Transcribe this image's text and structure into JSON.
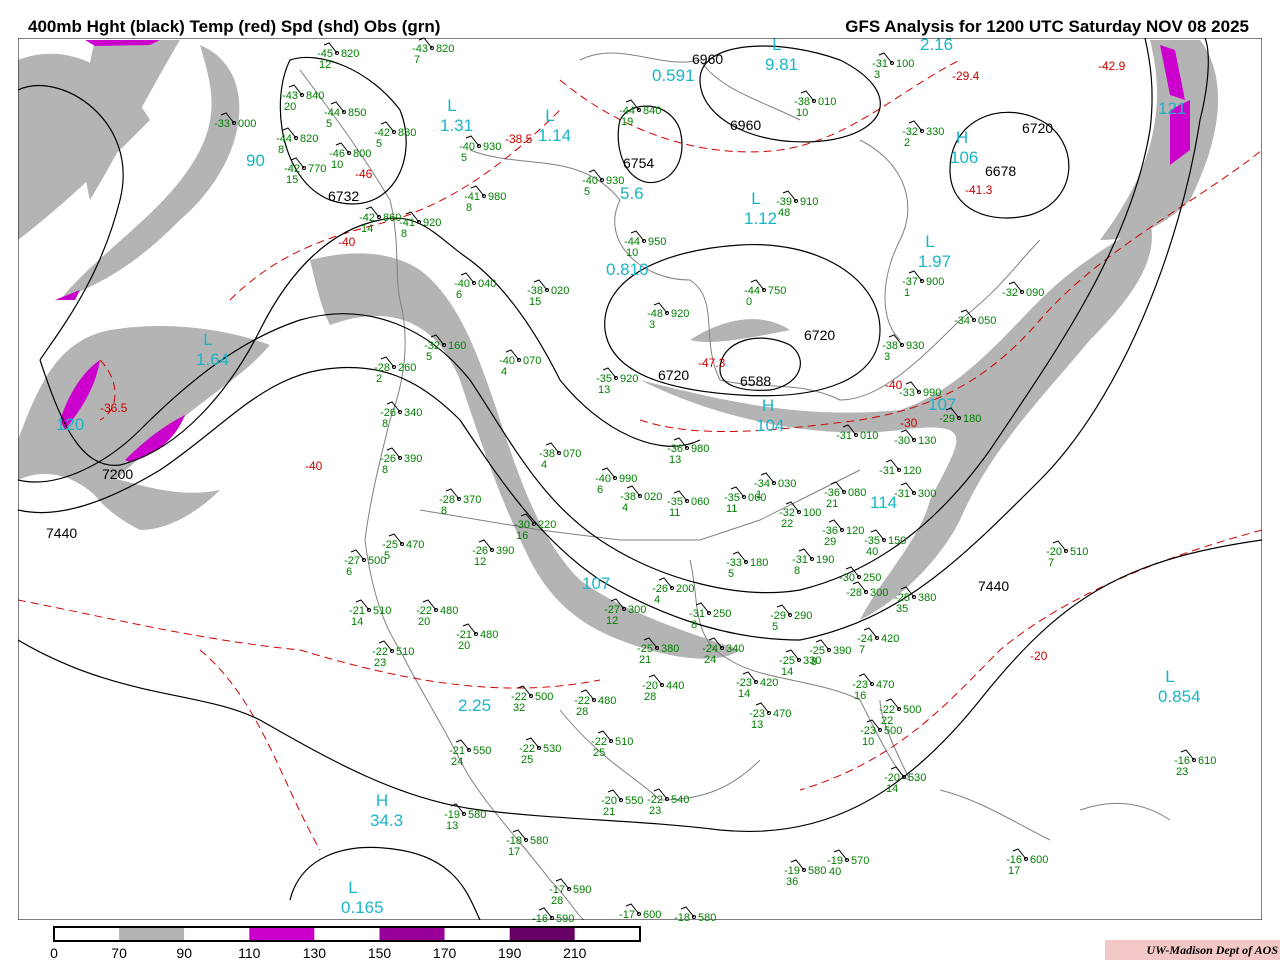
{
  "header": {
    "left_title": "400mb Hght (black) Temp (red) Spd (shd) Obs (grn)",
    "right_title": "GFS Analysis for 1200 UTC Saturday  NOV 08 2025"
  },
  "colors": {
    "height_contour": "#000000",
    "temp_contour": "#d00000",
    "obs": "#008000",
    "speed_label": "#19b5c8",
    "geography": "#808080"
  },
  "legend": {
    "labels": [
      "0",
      "70",
      "90",
      "110",
      "130",
      "150",
      "170",
      "190",
      "210"
    ],
    "colors": [
      "#ffffff",
      "#b4b4b4",
      "#ffffff",
      "#cc00cc",
      "#ffffff",
      "#990099",
      "#ffffff",
      "#660066",
      "#ffffff"
    ]
  },
  "credit": "UW-Madison   Dept of AOS",
  "height_labels": [
    "6732",
    "6754",
    "6960",
    "6960",
    "6720",
    "6678",
    "6720",
    "6720",
    "6588",
    "7200",
    "7440",
    "7440"
  ],
  "temp_labels": [
    "-38.5",
    "-36.5",
    "-29.4",
    "-42.9",
    "-41.3",
    "-47.3",
    "-40",
    "-40",
    "-30",
    "-20",
    "-40",
    "-46"
  ],
  "speed_centers": [
    {
      "type": "L",
      "value": "9.81"
    },
    {
      "type": "",
      "value": "0.591"
    },
    {
      "type": "L",
      "value": "1.31"
    },
    {
      "type": "L",
      "value": "1.14"
    },
    {
      "type": "",
      "value": "5.6"
    },
    {
      "type": "",
      "value": "90"
    },
    {
      "type": "L",
      "value": "1.64"
    },
    {
      "type": "",
      "value": "120"
    },
    {
      "type": "",
      "value": "0.810"
    },
    {
      "type": "L",
      "value": "1.12"
    },
    {
      "type": "L",
      "value": "1.97"
    },
    {
      "type": "H",
      "value": "106"
    },
    {
      "type": "",
      "value": "121"
    },
    {
      "type": "",
      "value": "2.16"
    },
    {
      "type": "",
      "value": "107"
    },
    {
      "type": "",
      "value": "2.25"
    },
    {
      "type": "H",
      "value": "34.3"
    },
    {
      "type": "L",
      "value": "0.165"
    },
    {
      "type": "L",
      "value": "0.854"
    },
    {
      "type": "H",
      "value": "104"
    },
    {
      "type": "",
      "value": "114"
    },
    {
      "type": "",
      "value": "107"
    }
  ],
  "observations": [
    [
      "-45",
      "820",
      "12"
    ],
    [
      "-43",
      "820",
      "7"
    ],
    [
      "-43",
      "840",
      "20"
    ],
    [
      "-44",
      "850",
      "5"
    ],
    [
      "-33",
      "000",
      ""
    ],
    [
      "-42",
      "880",
      "5"
    ],
    [
      "-44",
      "820",
      "8"
    ],
    [
      "-46",
      "800",
      "10"
    ],
    [
      "-42",
      "770",
      "15"
    ],
    [
      "-42",
      "860",
      "14"
    ],
    [
      "-41",
      "920",
      "8"
    ],
    [
      "-40",
      "930",
      "5"
    ],
    [
      "-41",
      "980",
      "8"
    ],
    [
      "-44",
      "840",
      "19"
    ],
    [
      "-40",
      "930",
      "5"
    ],
    [
      "-38",
      "010",
      "10"
    ],
    [
      "-31",
      "100",
      "3"
    ],
    [
      "-32",
      "330",
      "2"
    ],
    [
      "-39",
      "910",
      "48"
    ],
    [
      "-44",
      "950",
      "10"
    ],
    [
      "-37",
      "900",
      "1"
    ],
    [
      "-40",
      "040",
      "6"
    ],
    [
      "-38",
      "020",
      "15"
    ],
    [
      "-44",
      "750",
      "0"
    ],
    [
      "-48",
      "920",
      "3"
    ],
    [
      "-32",
      "090",
      ""
    ],
    [
      "-34",
      "050",
      ""
    ],
    [
      "-38",
      "930",
      "3"
    ],
    [
      "-32",
      "160",
      "5"
    ],
    [
      "-40",
      "070",
      "4"
    ],
    [
      "-35",
      "920",
      "13"
    ],
    [
      "-28",
      "260",
      "2"
    ],
    [
      "-26",
      "340",
      "8"
    ],
    [
      "-33",
      "990",
      ""
    ],
    [
      "-29",
      "180",
      ""
    ],
    [
      "-31",
      "010",
      ""
    ],
    [
      "-30",
      "130",
      ""
    ],
    [
      "-26",
      "390",
      "8"
    ],
    [
      "-38",
      "070",
      "4"
    ],
    [
      "-36",
      "980",
      "13"
    ],
    [
      "-31",
      "120",
      ""
    ],
    [
      "-40",
      "990",
      "6"
    ],
    [
      "-38",
      "020",
      "4"
    ],
    [
      "-35",
      "060",
      "11"
    ],
    [
      "-35",
      "060",
      "11"
    ],
    [
      "-34",
      "030",
      "1"
    ],
    [
      "-36",
      "080",
      "21"
    ],
    [
      "-31",
      "300",
      ""
    ],
    [
      "-28",
      "370",
      "8"
    ],
    [
      "-32",
      "100",
      "22"
    ],
    [
      "-30",
      "220",
      "16"
    ],
    [
      "-36",
      "120",
      "29"
    ],
    [
      "-35",
      "150",
      "40"
    ],
    [
      "-25",
      "470",
      "5"
    ],
    [
      "-26",
      "390",
      "12"
    ],
    [
      "-27",
      "500",
      "6"
    ],
    [
      "-33",
      "180",
      "5"
    ],
    [
      "-31",
      "190",
      "8"
    ],
    [
      "-30",
      "250",
      ""
    ],
    [
      "-28",
      "300",
      ""
    ],
    [
      "-25",
      "380",
      "35"
    ],
    [
      "-26",
      "200",
      "4"
    ],
    [
      "-27",
      "300",
      "12"
    ],
    [
      "-31",
      "250",
      "8"
    ],
    [
      "-21",
      "510",
      "14"
    ],
    [
      "-22",
      "480",
      "20"
    ],
    [
      "-29",
      "290",
      "5"
    ],
    [
      "-21",
      "480",
      "20"
    ],
    [
      "-24",
      "420",
      "7"
    ],
    [
      "-22",
      "510",
      "23"
    ],
    [
      "-25",
      "380",
      "21"
    ],
    [
      "-24",
      "340",
      "24"
    ],
    [
      "-25",
      "390",
      "8"
    ],
    [
      "-25",
      "330",
      "14"
    ],
    [
      "-20",
      "440",
      "28"
    ],
    [
      "-22",
      "500",
      "32"
    ],
    [
      "-22",
      "480",
      "28"
    ],
    [
      "-23",
      "420",
      "14"
    ],
    [
      "-23",
      "470",
      "16"
    ],
    [
      "-22",
      "500",
      "22"
    ],
    [
      "-23",
      "470",
      "13"
    ],
    [
      "-23",
      "500",
      "10"
    ],
    [
      "-21",
      "550",
      "24"
    ],
    [
      "-22",
      "530",
      "25"
    ],
    [
      "-22",
      "510",
      "25"
    ],
    [
      "-20",
      "530",
      "14"
    ],
    [
      "-16",
      "610",
      "23"
    ],
    [
      "-20",
      "510",
      "7"
    ],
    [
      "-20",
      "550",
      "21"
    ],
    [
      "-22",
      "540",
      "23"
    ],
    [
      "-19",
      "580",
      "13"
    ],
    [
      "-18",
      "580",
      "17"
    ],
    [
      "-17",
      "590",
      "28"
    ],
    [
      "-16",
      "590",
      ""
    ],
    [
      "-17",
      "600",
      ""
    ],
    [
      "-18",
      "580",
      ""
    ],
    [
      "-19",
      "580",
      "36"
    ],
    [
      "-19",
      "570",
      "40"
    ],
    [
      "-16",
      "600",
      "17"
    ]
  ]
}
